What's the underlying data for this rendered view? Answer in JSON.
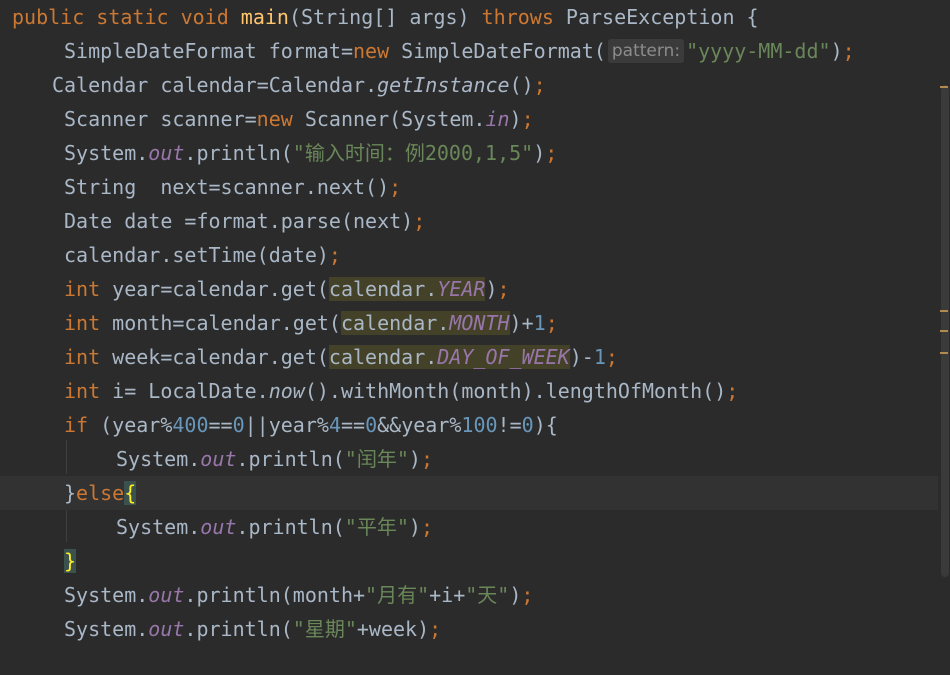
{
  "editor": {
    "hint": "pattern:",
    "lines": [
      [
        [
          "kw",
          "public static void "
        ],
        [
          "fn",
          "main"
        ],
        [
          "p",
          "(String[] args) "
        ],
        [
          "kw",
          "throws "
        ],
        [
          "p",
          "ParseException {"
        ]
      ],
      [
        [
          "p",
          "SimpleDateFormat format="
        ],
        [
          "kw",
          "new "
        ],
        [
          "p",
          "SimpleDateFormat("
        ],
        [
          "hint",
          ""
        ],
        [
          "str",
          "\"yyyy-MM-dd\""
        ],
        [
          "p",
          ")"
        ],
        [
          "semi",
          ";"
        ]
      ],
      [
        [
          "p",
          "Calendar calendar=Calendar."
        ],
        [
          "static",
          "getInstance"
        ],
        [
          "p",
          "()"
        ],
        [
          "semi",
          ";"
        ]
      ],
      [
        [
          "p",
          "Scanner scanner="
        ],
        [
          "kw",
          "new "
        ],
        [
          "p",
          "Scanner(System."
        ],
        [
          "field",
          "in"
        ],
        [
          "p",
          ")"
        ],
        [
          "semi",
          ";"
        ]
      ],
      [
        [
          "p",
          "System."
        ],
        [
          "field",
          "out"
        ],
        [
          "p",
          ".println("
        ],
        [
          "str",
          "\"输入时间：例2000,1,5\""
        ],
        [
          "p",
          ")"
        ],
        [
          "semi",
          ";"
        ]
      ],
      [
        [
          "p",
          "String  next=scanner.next()"
        ],
        [
          "semi",
          ";"
        ]
      ],
      [
        [
          "p",
          "Date date =format.parse(next)"
        ],
        [
          "semi",
          ";"
        ]
      ],
      [
        [
          "p",
          "calendar.setTime(date)"
        ],
        [
          "semi",
          ";"
        ]
      ],
      [
        [
          "kw",
          "int "
        ],
        [
          "p",
          "year=calendar.get("
        ],
        [
          "hl",
          "calendar."
        ],
        [
          "hlf",
          "YEAR"
        ],
        [
          "p",
          ")"
        ],
        [
          "semi",
          ";"
        ]
      ],
      [
        [
          "kw",
          "int "
        ],
        [
          "p",
          "month=calendar.get("
        ],
        [
          "hl",
          "calendar."
        ],
        [
          "hlf",
          "MONTH"
        ],
        [
          "p",
          ")+"
        ],
        [
          "num",
          "1"
        ],
        [
          "semi",
          ";"
        ]
      ],
      [
        [
          "kw",
          "int "
        ],
        [
          "p",
          "week=calendar.get("
        ],
        [
          "hl",
          "calendar."
        ],
        [
          "hlf",
          "DAY_OF_WEEK"
        ],
        [
          "p",
          ")-"
        ],
        [
          "num",
          "1"
        ],
        [
          "semi",
          ";"
        ]
      ],
      [
        [
          "kw",
          "int "
        ],
        [
          "p",
          "i= LocalDate."
        ],
        [
          "static",
          "now"
        ],
        [
          "p",
          "().withMonth(month).lengthOfMonth()"
        ],
        [
          "semi",
          ";"
        ]
      ],
      [
        [
          "kw",
          "if "
        ],
        [
          "p",
          "(year%"
        ],
        [
          "num",
          "400"
        ],
        [
          "p",
          "=="
        ],
        [
          "num",
          "0"
        ],
        [
          "p",
          "||year%"
        ],
        [
          "num",
          "4"
        ],
        [
          "p",
          "=="
        ],
        [
          "num",
          "0"
        ],
        [
          "p",
          "&&year%"
        ],
        [
          "num",
          "100"
        ],
        [
          "p",
          "!="
        ],
        [
          "num",
          "0"
        ],
        [
          "p",
          "){"
        ]
      ],
      [
        [
          "p",
          "System."
        ],
        [
          "field",
          "out"
        ],
        [
          "p",
          ".println("
        ],
        [
          "str",
          "\"闰年\""
        ],
        [
          "p",
          ")"
        ],
        [
          "semi",
          ";"
        ]
      ],
      [
        [
          "p",
          "}"
        ],
        [
          "kw",
          "else"
        ],
        [
          "bm",
          "{"
        ]
      ],
      [
        [
          "p",
          "System."
        ],
        [
          "field",
          "out"
        ],
        [
          "p",
          ".println("
        ],
        [
          "str",
          "\"平年\""
        ],
        [
          "p",
          ")"
        ],
        [
          "semi",
          ";"
        ]
      ],
      [
        [
          "bm",
          "}"
        ]
      ],
      [
        [
          "p",
          "System."
        ],
        [
          "field",
          "out"
        ],
        [
          "p",
          ".println(month+"
        ],
        [
          "str",
          "\"月有\""
        ],
        [
          "p",
          "+i+"
        ],
        [
          "str",
          "\"天\""
        ],
        [
          "p",
          ")"
        ],
        [
          "semi",
          ";"
        ]
      ],
      [
        [
          "p",
          "System."
        ],
        [
          "field",
          "out"
        ],
        [
          "p",
          ".println("
        ],
        [
          "str",
          "\"星期\""
        ],
        [
          "p",
          "+week)"
        ],
        [
          "semi",
          ";"
        ]
      ]
    ]
  }
}
